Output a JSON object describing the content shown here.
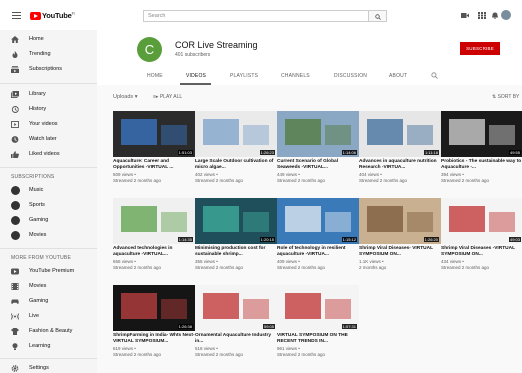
{
  "app": {
    "logo_text": "YouTube",
    "logo_sup": "IN",
    "search_placeholder": "Search"
  },
  "sidebar": {
    "main_items": [
      {
        "label": "Home",
        "icon": "home-icon"
      },
      {
        "label": "Trending",
        "icon": "trending-icon"
      },
      {
        "label": "Subscriptions",
        "icon": "subscriptions-icon"
      }
    ],
    "library_items": [
      {
        "label": "Library",
        "icon": "library-icon"
      },
      {
        "label": "History",
        "icon": "history-icon"
      },
      {
        "label": "Your videos",
        "icon": "your-videos-icon"
      },
      {
        "label": "Watch later",
        "icon": "watch-later-icon"
      },
      {
        "label": "Liked videos",
        "icon": "liked-icon"
      }
    ],
    "subscriptions_heading": "SUBSCRIPTIONS",
    "subscriptions": [
      {
        "label": "Music"
      },
      {
        "label": "Sports"
      },
      {
        "label": "Gaming"
      },
      {
        "label": "Movies"
      }
    ],
    "more_heading": "MORE FROM YOUTUBE",
    "more_items": [
      {
        "label": "YouTube Premium",
        "icon": "youtube-premium-icon"
      },
      {
        "label": "Movies",
        "icon": "movies-icon"
      },
      {
        "label": "Gaming",
        "icon": "gaming-icon"
      },
      {
        "label": "Live",
        "icon": "live-icon"
      },
      {
        "label": "Fashion & Beauty",
        "icon": "fashion-icon"
      },
      {
        "label": "Learning",
        "icon": "learning-icon"
      }
    ],
    "settings_label": "Settings"
  },
  "channel": {
    "avatar_letter": "C",
    "name": "COR Live Streaming",
    "subscribers": "401 subscribers",
    "subscribe_label": "SUBSCRIBE",
    "tabs": [
      "HOME",
      "VIDEOS",
      "PLAYLISTS",
      "CHANNELS",
      "DISCUSSION",
      "ABOUT"
    ],
    "active_tab": "VIDEOS"
  },
  "uploads": {
    "label": "Uploads ▾",
    "play_all": "PLAY ALL",
    "sort_by": "SORT BY"
  },
  "videos": [
    {
      "title": "Aquaculture: Career and Opportunities -VIRTUAL ...",
      "views": "509 views",
      "date": "Streamed 2 months ago",
      "duration": "1:51:03",
      "thumb_bg": "#2b2b2b",
      "thumb_fg": "#3a78c8"
    },
    {
      "title": "Large Scale Outdoor cultivation of micro algae...",
      "views": "402 views",
      "date": "Streamed 2 months ago",
      "duration": "1:26:23",
      "thumb_bg": "#eaeaea",
      "thumb_fg": "#7aa0c8"
    },
    {
      "title": "Current Scenario of Global Seaweeds -VIRTUAL...",
      "views": "449 views",
      "date": "Streamed 2 months ago",
      "duration": "1:14:06",
      "thumb_bg": "#8aa7c4",
      "thumb_fg": "#4f7a3a"
    },
    {
      "title": "Advances in aquaculture nutrition Research -VIRTUA...",
      "views": "404 views",
      "date": "Streamed 2 months ago",
      "duration": "1:11:18",
      "thumb_bg": "#e6e6e6",
      "thumb_fg": "#3b6b9a"
    },
    {
      "title": "Probiotics - The sustainable way to Aquaculture -...",
      "views": "394 views",
      "date": "Streamed 2 months ago",
      "duration": "49:55",
      "thumb_bg": "#1a1a1a",
      "thumb_fg": "#d9d9d9"
    },
    {
      "title": "Advanced technologies in aquaculture -VIRTUAL...",
      "views": "655 views",
      "date": "Streamed 2 months ago",
      "duration": "1:14:35",
      "thumb_bg": "#f0f0f0",
      "thumb_fg": "#5aa04a"
    },
    {
      "title": "Minimising production cost for sustainable shrimp...",
      "views": "355 views",
      "date": "Streamed 2 months ago",
      "duration": "1:20:15",
      "thumb_bg": "#1f4f5a",
      "thumb_fg": "#40b0a0"
    },
    {
      "title": "Role of technology in resilient aquaculture -VIRTUA...",
      "views": "409 views",
      "date": "Streamed 2 months ago",
      "duration": "1:15:12",
      "thumb_bg": "#3a7ab8",
      "thumb_fg": "#e8eef4"
    },
    {
      "title": "Shrimp Viral Diseases- VIRTUAL SYMPOSIUM ON...",
      "views": "1.1K views",
      "date": "2 months ago",
      "duration": "1:26:20",
      "thumb_bg": "#c8b090",
      "thumb_fg": "#7a5a3a"
    },
    {
      "title": "Shrimp Viral Diseases -VIRTUAL SYMPOSIUM ON...",
      "views": "434 views",
      "date": "Streamed 2 months ago",
      "duration": "49:03",
      "thumb_bg": "#f4f4f4",
      "thumb_fg": "#c03030"
    },
    {
      "title": "ShrimpFarming in India- Whts Next-VIRTUAL SYMPOSIUM...",
      "views": "619 views",
      "date": "Streamed 2 months ago",
      "duration": "1:26:38",
      "thumb_bg": "#151515",
      "thumb_fg": "#c04040"
    },
    {
      "title": "Ornamental Aquaculture Industry in...",
      "views": "518 views",
      "date": "Streamed 2 months ago",
      "duration": "59:05",
      "thumb_bg": "#f4f4f4",
      "thumb_fg": "#c03030"
    },
    {
      "title": "VIRTUAL SYMPOSIUM ON THE RECENT TRENDS IN...",
      "views": "961 views",
      "date": "Streamed 2 months ago",
      "duration": "1:57:31",
      "thumb_bg": "#f4f4f4",
      "thumb_fg": "#c03030"
    }
  ]
}
